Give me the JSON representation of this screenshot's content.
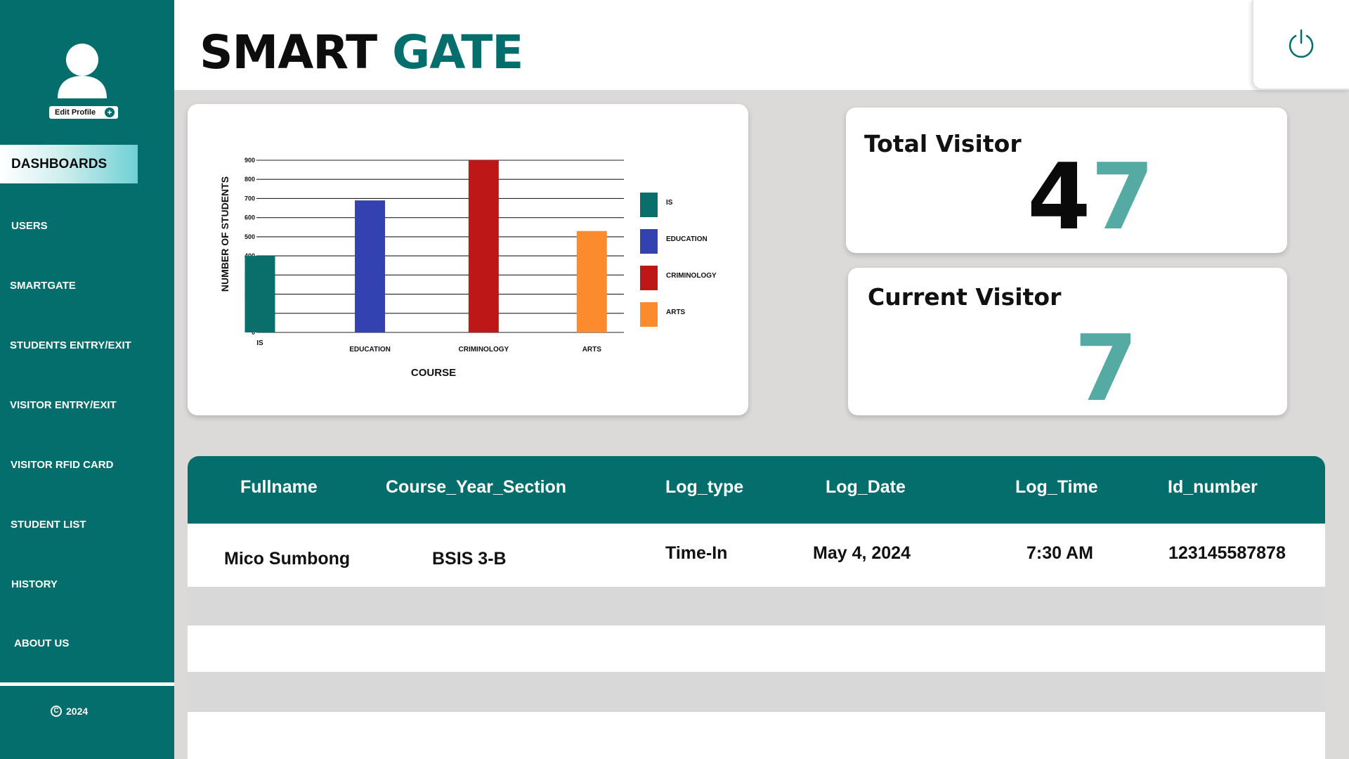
{
  "app": {
    "title_part1": "SMART",
    "title_part2": "GATE"
  },
  "sidebar": {
    "edit_profile_label": "Edit Profile",
    "items": [
      {
        "label": "DASHBOARDS",
        "active": true
      },
      {
        "label": "USERS"
      },
      {
        "label": "SMARTGATE"
      },
      {
        "label": "STUDENTS ENTRY/EXIT"
      },
      {
        "label": "VISITOR ENTRY/EXIT"
      },
      {
        "label": "VISITOR RFID CARD"
      },
      {
        "label": "STUDENT LIST"
      },
      {
        "label": "HISTORY"
      },
      {
        "label": "ABOUT US"
      }
    ],
    "copyright": "2024"
  },
  "header": {
    "power_icon": "power-icon"
  },
  "stats": {
    "total_label": "Total Visitor",
    "total_digit1": "4",
    "total_digit2": "7",
    "current_label": "Current Visitor",
    "current_value": "7"
  },
  "chart_data": {
    "type": "bar",
    "categories": [
      "IS",
      "EDUCATION",
      "CRIMINOLOGY",
      "ARTS"
    ],
    "values": [
      400,
      690,
      900,
      530
    ],
    "colors": [
      "#0a6e6a",
      "#3342b0",
      "#be1718",
      "#fb8b2c"
    ],
    "xlabel": "COURSE",
    "ylabel": "NUMBER OF STUDENTS",
    "ylim": [
      0,
      900
    ],
    "yticks": [
      "0",
      "100",
      "200",
      "300",
      "400",
      "500",
      "600",
      "700",
      "800",
      "900"
    ],
    "legend": [
      "IS",
      "EDUCATION",
      "CRIMINOLOGY",
      "ARTS"
    ],
    "legend_position": "right",
    "grid": true
  },
  "table": {
    "headers": [
      "Fullname",
      "Course_Year_Section",
      "Log_type",
      "Log_Date",
      "Log_Time",
      "Id_number"
    ],
    "rows": [
      [
        "Mico Sumbong",
        "BSIS 3-B",
        "Time-In",
        "May 4, 2024",
        "7:30 AM",
        "123145587878"
      ]
    ]
  },
  "colors": {
    "primary": "#036e6b",
    "accent_teal": "#55aba3",
    "background": "#dcdad9"
  }
}
